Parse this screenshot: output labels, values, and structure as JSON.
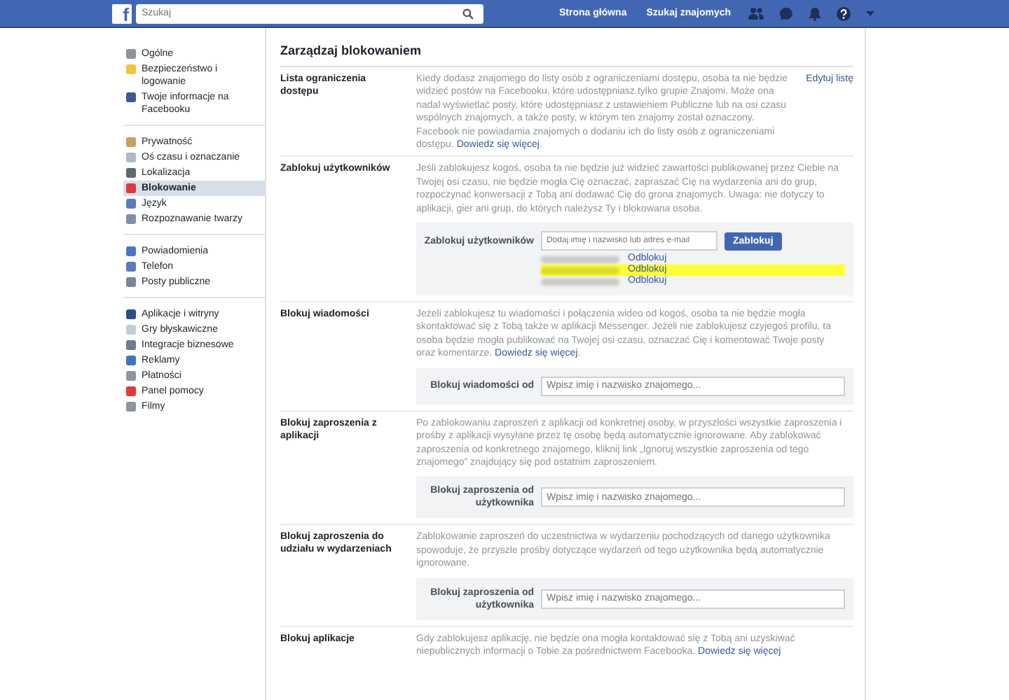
{
  "top_bar": {
    "logo": "f",
    "search": {
      "placeholder": "Szukaj"
    },
    "nav": [
      "Strona główna",
      "Szukaj znajomych"
    ]
  },
  "sidebar": {
    "groups": [
      [
        {
          "label": "Ogólne",
          "selected": false,
          "color": "#8d949e"
        },
        {
          "label": "Bezpieczeństwo i logowanie",
          "selected": false,
          "color": "#f5c33b"
        },
        {
          "label": "Twoje informacje na Facebooku",
          "selected": false,
          "color": "#3b5998"
        }
      ],
      [
        {
          "label": "Prywatność",
          "selected": false,
          "color": "#c9a15a"
        },
        {
          "label": "Oś czasu i oznaczanie",
          "selected": false,
          "color": "#b0b8c4"
        },
        {
          "label": "Lokalizacja",
          "selected": false,
          "color": "#606770"
        },
        {
          "label": "Blokowanie",
          "selected": true,
          "color": "#e0393e"
        },
        {
          "label": "Język",
          "selected": false,
          "color": "#5b7bbf"
        },
        {
          "label": "Rozpoznawanie twarzy",
          "selected": false,
          "color": "#7f8ea8"
        }
      ],
      [
        {
          "label": "Powiadomienia",
          "selected": false,
          "color": "#4a76c8"
        },
        {
          "label": "Telefon",
          "selected": false,
          "color": "#5b7bbf"
        },
        {
          "label": "Posty publiczne",
          "selected": false,
          "color": "#7a8598"
        }
      ],
      [
        {
          "label": "Aplikacje i witryny",
          "selected": false,
          "color": "#2d4f8a"
        },
        {
          "label": "Gry błyskawiczne",
          "selected": false,
          "color": "#c4ccd6"
        },
        {
          "label": "Integracje biznesowe",
          "selected": false,
          "color": "#707b8c"
        },
        {
          "label": "Reklamy",
          "selected": false,
          "color": "#3f74c4"
        },
        {
          "label": "Płatności",
          "selected": false,
          "color": "#8d949e"
        },
        {
          "label": "Panel pomocy",
          "selected": false,
          "color": "#e0393e"
        },
        {
          "label": "Filmy",
          "selected": false,
          "color": "#8d949e"
        }
      ]
    ]
  },
  "main": {
    "title": "Zarządzaj blokowaniem",
    "sections": [
      {
        "kind": "info",
        "label": "Lista ograniczenia dostępu",
        "description": "Kiedy dodasz znajomego do listy osób z ograniczeniami dostępu, osoba ta nie będzie widzieć postów na Facebooku, które udostępniasz tylko grupie Znajomi. Może ona nadal wyświetlać posty, które udostępniasz z ustawieniem Publiczne lub na osi czasu wspólnych znajomych, a także posty, w którym ten znajomy został oznaczony. Facebook nie powiadamia znajomych o dodaniu ich do listy osób z ograniczeniami dostępu.",
        "learn_more": "Dowiedz się więcej",
        "after_link": ".",
        "action": "Edytuj listę"
      },
      {
        "kind": "form",
        "label": "Zablokuj użytkowników",
        "description": "Jeśli zablokujesz kogoś, osoba ta nie będzie już widzieć zawartości publikowanej przez Ciebie na Twojej osi czasu, nie będzie mogła Cię oznaczać, zapraszać Cię na wydarzenia ani do grup, rozpoczynać konwersacji z Tobą ani dodawać Cię do grona znajomych. Uwaga: nie dotyczy to aplikacji, gier ani grup, do których należysz Ty i blokowana osoba.",
        "form": {
          "label": "Zablokuj użytkowników",
          "placeholder": "Dodaj imię i nazwisko lub adres e-mail",
          "button": "Zablokuj"
        },
        "blocked": [
          {
            "action": "Odblokuj",
            "highlighted": false
          },
          {
            "action": "Odblokuj",
            "highlighted": true
          },
          {
            "action": "Odblokuj",
            "highlighted": false
          }
        ]
      },
      {
        "kind": "form",
        "label": "Blokuj wiadomości",
        "description": "Jeżeli zablokujesz tu wiadomości i połączenia wideo od kogoś, osoba ta nie będzie mogła skontaktować się z Tobą także w aplikacji Messenger. Jeżeli nie zablokujesz czyjegoś profilu, ta osoba będzie mogła publikować na Twojej osi czasu, oznaczać Cię i komentować Twoje posty oraz komentarze.",
        "learn_more": "Dowiedz się więcej",
        "after_link": ".",
        "form": {
          "label": "Blokuj wiadomości od",
          "placeholder": "Wpisz imię i nazwisko znajomego..."
        }
      },
      {
        "kind": "form",
        "label": "Blokuj zaproszenia z aplikacji",
        "description": "Po zablokowaniu zaproszeń z aplikacji od konkretnej osoby, w przyszłości wszystkie zaproszenia i prośby z aplikacji wysyłane przez tę osobę będą automatycznie ignorowane. Aby zablokować zaproszenia od konkretnego znajomego, kliknij link „Ignoruj wszystkie zaproszenia od tego znajomego” znajdujący się pod ostatnim zaproszeniem.",
        "form": {
          "label": "Blokuj zaproszenia od użytkownika",
          "placeholder": "Wpisz imię i nazwisko znajomego..."
        }
      },
      {
        "kind": "form",
        "label": "Blokuj zaproszenia do udziału w wydarzeniach",
        "description": "Zablokowanie zaproszeń do uczestnictwa w wydarzeniu pochodzących od danego użytkownika spowoduje, że przyszłe prośby dotyczące wydarzeń od tego użytkownika będą automatycznie ignorowane.",
        "form": {
          "label": "Blokuj zaproszenia od użytkownika",
          "placeholder": "Wpisz imię i nazwisko znajomego..."
        }
      },
      {
        "kind": "info",
        "label": "Blokuj aplikacje",
        "description": "Gdy zablokujesz aplikację, nie będzie ona mogła kontaktować się z Tobą ani uzyskiwać niepublicznych informacji o Tobie za pośrednictwem Facebooka.",
        "learn_more": "Dowiedz się więcej"
      }
    ]
  }
}
